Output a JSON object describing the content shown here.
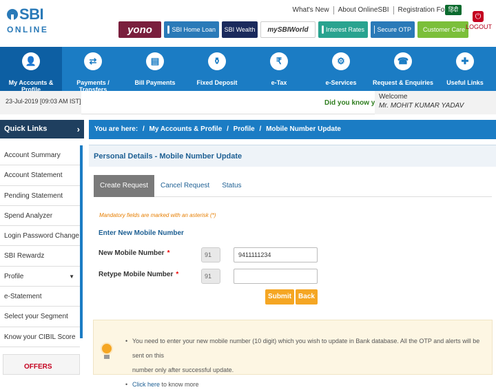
{
  "header": {
    "brand": "SBI",
    "brand_sub": "ONLINE",
    "top_links": [
      "What's New",
      "About OnlineSBI",
      "Registration Forms"
    ],
    "hindi_label": "हिंदी",
    "promos": {
      "yono": "yono",
      "homeloan": "SBI Home Loan",
      "wealth": "SBI Wealth",
      "sbiworld": "mySBIWorld",
      "interest": "Interest Rates",
      "secureotp": "Secure OTP",
      "customercare": "Customer Care"
    },
    "logout_label": "LOGOUT"
  },
  "nav": [
    {
      "label": "My Accounts & Profile",
      "icon": "account-icon",
      "active": true
    },
    {
      "label": "Payments / Transfers",
      "icon": "transfer-icon",
      "active": false
    },
    {
      "label": "Bill Payments",
      "icon": "bill-icon",
      "active": false
    },
    {
      "label": "Fixed Deposit",
      "icon": "deposit-icon",
      "active": false
    },
    {
      "label": "e-Tax",
      "icon": "tax-icon",
      "active": false
    },
    {
      "label": "e-Services",
      "icon": "services-icon",
      "active": false
    },
    {
      "label": "Request & Enquiries",
      "icon": "request-icon",
      "active": false
    },
    {
      "label": "Useful Links",
      "icon": "links-icon",
      "active": false
    }
  ],
  "info": {
    "datetime": "23-Jul-2019 [09:03 AM IST]",
    "did_you_know": "Did you know y",
    "welcome_label": "Welcome",
    "user_name": "Mr. MOHIT KUMAR YADAV"
  },
  "sidebar": {
    "title": "Quick Links",
    "items": [
      "Account Summary",
      "Account Statement",
      "Pending Statement",
      "Spend Analyzer",
      "Login Password Change",
      "SBI Rewardz",
      "Profile",
      "e-Statement",
      "Select your Segment",
      "Know your CIBIL Score"
    ],
    "offers_label": "OFFERS"
  },
  "breadcrumb": {
    "prefix": "You are here:",
    "sep": "/",
    "items": [
      "My Accounts & Profile",
      "Profile",
      "Mobile Number Update"
    ]
  },
  "panel": {
    "title": "Personal Details - Mobile Number Update",
    "tabs": [
      "Create Request",
      "Cancel Request",
      "Status"
    ],
    "mandatory_note": "Mandatory fields are marked with an asterisk (*)",
    "section_header": "Enter New Mobile Number",
    "new_mobile_label": "New Mobile Number",
    "retype_label": "Retype Mobile Number",
    "asterisk": "*",
    "country_code": "91",
    "new_mobile_value": "9411111234",
    "retype_value": "",
    "submit_label": "Submit",
    "back_label": "Back",
    "note_line1": "You need to enter your new mobile number (10 digit) which you wish to update in Bank database. All the OTP and alerts will be sent on this",
    "note_line2": "number only after successful update.",
    "note_link": "Click here",
    "note_link_suffix": " to know more"
  },
  "colors": {
    "primary_blue": "#1b7cc4",
    "dark_nav": "#1f3f5f",
    "accent_orange": "#f5a623",
    "title_blue": "#1d5f93",
    "alert_red": "#c4001f"
  }
}
